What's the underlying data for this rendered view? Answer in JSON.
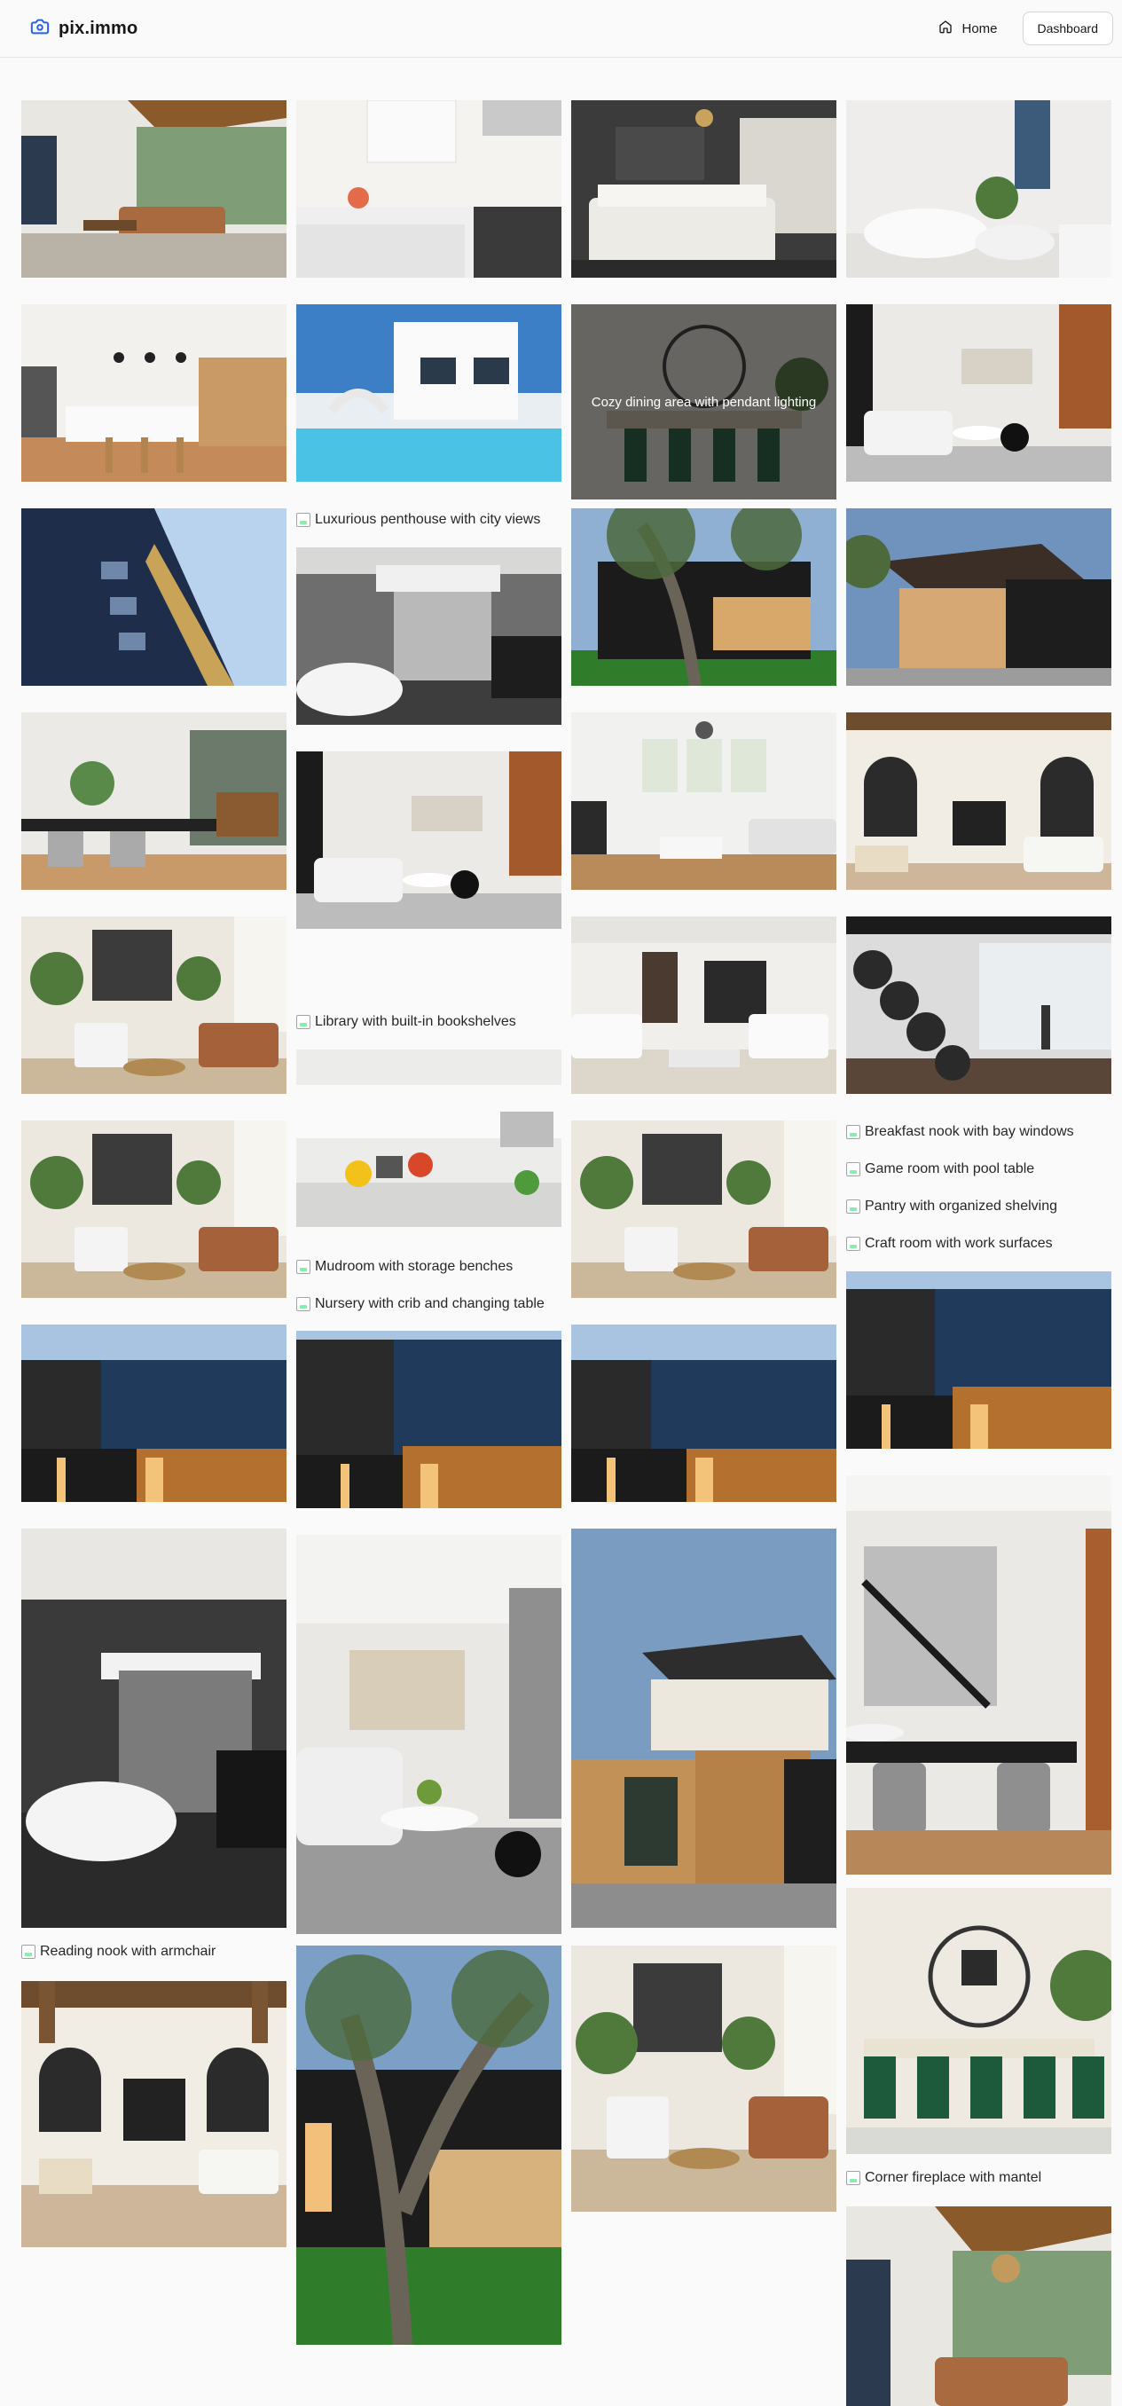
{
  "header": {
    "brand": "pix.immo",
    "nav_home": "Home",
    "nav_dashboard": "Dashboard"
  },
  "gallery": {
    "hover_caption": "Cozy dining area with pendant lighting",
    "missing_images": [
      "Luxurious penthouse with city views",
      "Library with built-in bookshelves",
      "Breakfast nook with bay windows",
      "Game room with pool table",
      "Pantry with organized shelving",
      "Craft room with work surfaces",
      "Mudroom with storage benches",
      "Nursery with crib and changing table",
      "Reading nook with armchair",
      "Corner fireplace with mantel"
    ]
  },
  "colors": {
    "accent": "#2563eb",
    "page_bg": "#fafafa",
    "border": "#e4e4e7"
  }
}
